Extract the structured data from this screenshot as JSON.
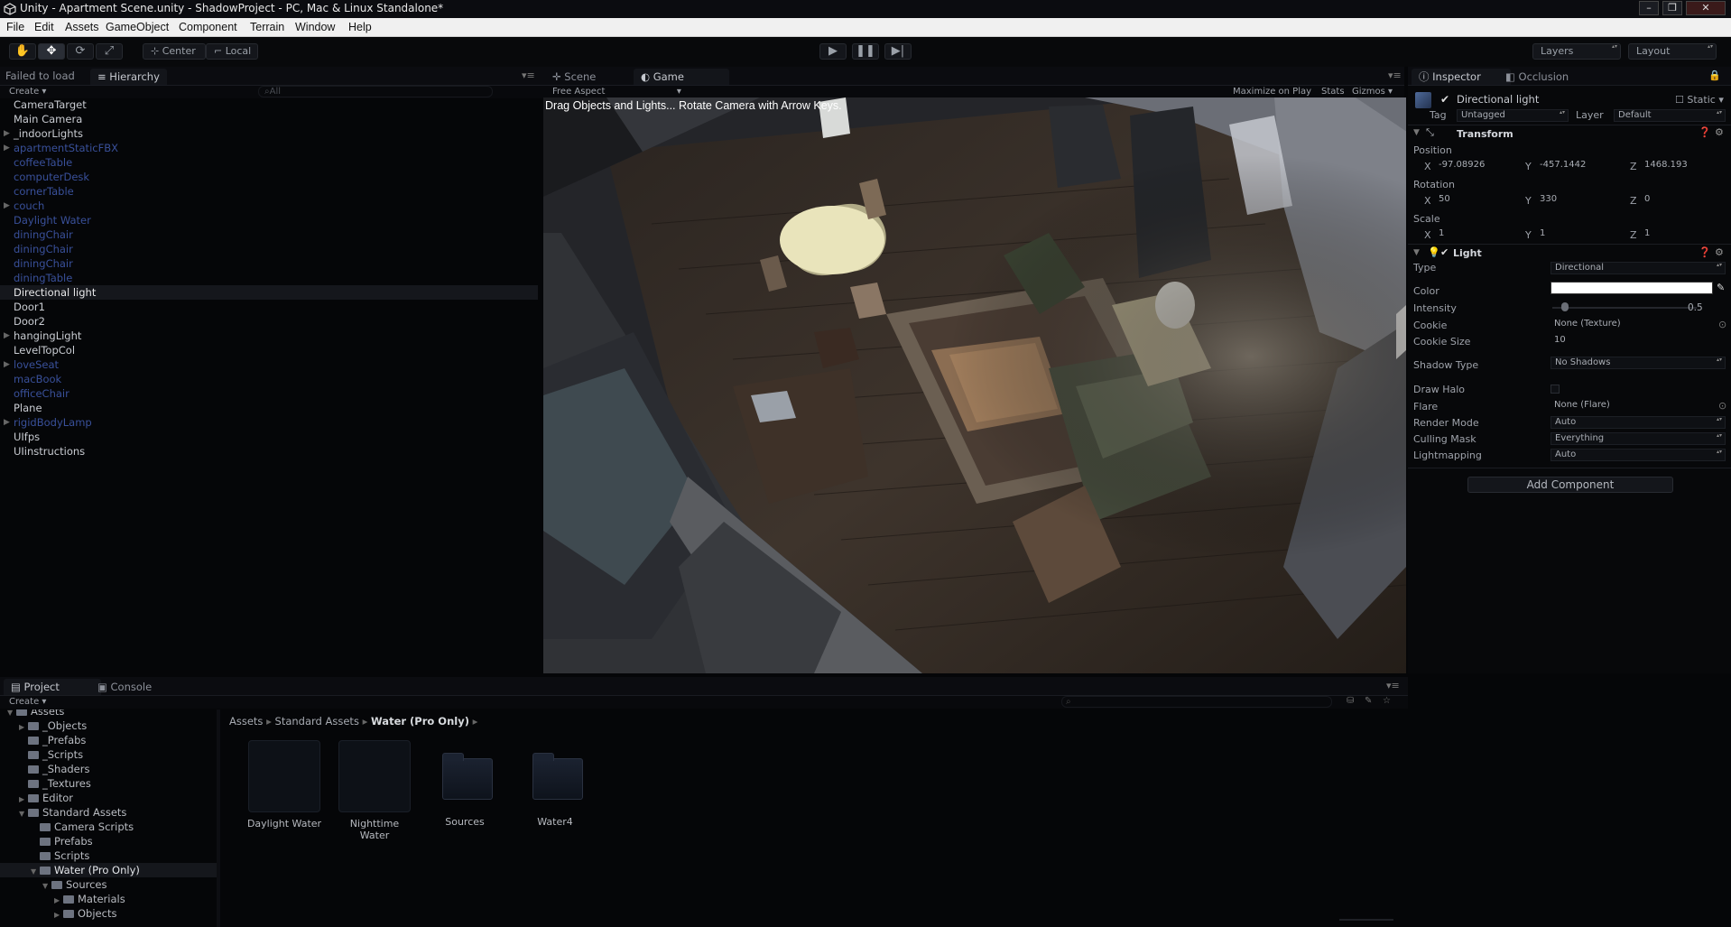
{
  "window": {
    "title": "Unity - Apartment Scene.unity - ShadowProject - PC, Mac & Linux Standalone*"
  },
  "menu": [
    "File",
    "Edit",
    "Assets",
    "GameObject",
    "Component",
    "Terrain",
    "Window",
    "Help"
  ],
  "toolbar": {
    "pivot": "Center",
    "space": "Local",
    "layers": "Layers",
    "layout": "Layout"
  },
  "hierarchy": {
    "status": "Failed to load",
    "tab": "Hierarchy",
    "create": "Create",
    "search_placeholder": "All",
    "items": [
      {
        "label": "CameraTarget",
        "color": "white",
        "arrow": false
      },
      {
        "label": "Main Camera",
        "color": "white",
        "arrow": false
      },
      {
        "label": "_indoorLights",
        "color": "white",
        "arrow": true
      },
      {
        "label": "apartmentStaticFBX",
        "color": "blue",
        "arrow": true
      },
      {
        "label": "coffeeTable",
        "color": "blue",
        "arrow": false
      },
      {
        "label": "computerDesk",
        "color": "blue",
        "arrow": false
      },
      {
        "label": "cornerTable",
        "color": "blue",
        "arrow": false
      },
      {
        "label": "couch",
        "color": "blue",
        "arrow": true
      },
      {
        "label": "Daylight Water",
        "color": "blue",
        "arrow": false
      },
      {
        "label": "diningChair",
        "color": "blue",
        "arrow": false
      },
      {
        "label": "diningChair",
        "color": "blue",
        "arrow": false
      },
      {
        "label": "diningChair",
        "color": "blue",
        "arrow": false
      },
      {
        "label": "diningTable",
        "color": "blue",
        "arrow": false
      },
      {
        "label": "Directional light",
        "color": "selected",
        "arrow": false
      },
      {
        "label": "Door1",
        "color": "white",
        "arrow": false
      },
      {
        "label": "Door2",
        "color": "white",
        "arrow": false
      },
      {
        "label": "hangingLight",
        "color": "white",
        "arrow": true
      },
      {
        "label": "LevelTopCol",
        "color": "white",
        "arrow": false
      },
      {
        "label": "loveSeat",
        "color": "blue",
        "arrow": true
      },
      {
        "label": "macBook",
        "color": "blue",
        "arrow": false
      },
      {
        "label": "officeChair",
        "color": "blue",
        "arrow": false
      },
      {
        "label": "Plane",
        "color": "white",
        "arrow": false
      },
      {
        "label": "rigidBodyLamp",
        "color": "blue",
        "arrow": true
      },
      {
        "label": "UIfps",
        "color": "white",
        "arrow": false
      },
      {
        "label": "UIinstructions",
        "color": "white",
        "arrow": false
      }
    ]
  },
  "game": {
    "scene_tab": "Scene",
    "game_tab": "Game",
    "aspect": "Free Aspect",
    "maximize": "Maximize on Play",
    "stats": "Stats",
    "gizmos": "Gizmos",
    "overlay": "Drag Objects and Lights... Rotate Camera with Arrow Keys."
  },
  "inspector": {
    "tab": "Inspector",
    "occlusion_tab": "Occlusion",
    "object_name": "Directional light",
    "static": "Static",
    "tag_label": "Tag",
    "tag_value": "Untagged",
    "layer_label": "Layer",
    "layer_value": "Default",
    "transform": {
      "title": "Transform",
      "position_label": "Position",
      "position": {
        "x": "-97.08926",
        "y": "-457.1442",
        "z": "1468.193"
      },
      "rotation_label": "Rotation",
      "rotation": {
        "x": "50",
        "y": "330",
        "z": "0"
      },
      "scale_label": "Scale",
      "scale": {
        "x": "1",
        "y": "1",
        "z": "1"
      },
      "x": "X",
      "y": "Y",
      "z": "Z"
    },
    "light": {
      "title": "Light",
      "type_label": "Type",
      "type_value": "Directional",
      "color_label": "Color",
      "color_value": "#ffffff",
      "intensity_label": "Intensity",
      "intensity_value": "0.5",
      "cookie_label": "Cookie",
      "cookie_value": "None (Texture)",
      "cookie_size_label": "Cookie Size",
      "cookie_size_value": "10",
      "shadow_label": "Shadow Type",
      "shadow_value": "No Shadows",
      "halo_label": "Draw Halo",
      "flare_label": "Flare",
      "flare_value": "None (Flare)",
      "render_label": "Render Mode",
      "render_value": "Auto",
      "culling_label": "Culling Mask",
      "culling_value": "Everything",
      "lightmapping_label": "Lightmapping",
      "lightmapping_value": "Auto"
    },
    "add_component": "Add Component"
  },
  "project": {
    "tab": "Project",
    "console_tab": "Console",
    "create": "Create",
    "tree": [
      {
        "label": "Assets",
        "depth": 0
      },
      {
        "label": "_Objects",
        "depth": 1
      },
      {
        "label": "_Prefabs",
        "depth": 1
      },
      {
        "label": "_Scripts",
        "depth": 1
      },
      {
        "label": "_Shaders",
        "depth": 1
      },
      {
        "label": "_Textures",
        "depth": 1
      },
      {
        "label": "Editor",
        "depth": 1
      },
      {
        "label": "Standard Assets",
        "depth": 1
      },
      {
        "label": "Camera Scripts",
        "depth": 2
      },
      {
        "label": "Prefabs",
        "depth": 2
      },
      {
        "label": "Scripts",
        "depth": 2
      },
      {
        "label": "Water (Pro Only)",
        "depth": 2
      },
      {
        "label": "Sources",
        "depth": 3
      },
      {
        "label": "Materials",
        "depth": 4
      },
      {
        "label": "Objects",
        "depth": 4
      }
    ],
    "breadcrumb": [
      "Assets",
      "Standard Assets",
      "Water (Pro Only)"
    ],
    "assets": [
      {
        "label": "Daylight Water",
        "kind": "prefab"
      },
      {
        "label": "Nighttime Water",
        "kind": "prefab"
      },
      {
        "label": "Sources",
        "kind": "folder"
      },
      {
        "label": "Water4",
        "kind": "folder"
      }
    ]
  }
}
